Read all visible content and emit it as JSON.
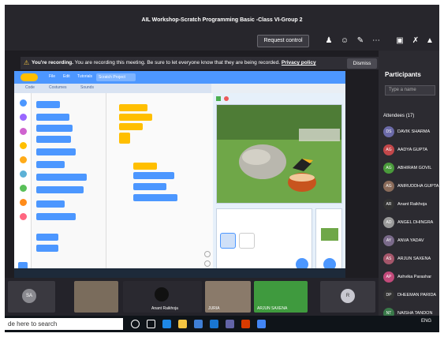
{
  "meeting": {
    "title": "AIL Workshop-Scratch Programming Basic -Class VI-Group 2",
    "request_control": "Request control"
  },
  "banner": {
    "lead": "You're recording.",
    "message": "You are recording this meeting. Be sure to let everyone know that they are being recorded.",
    "policy_link": "Privacy policy",
    "dismiss": "Dismiss"
  },
  "participants": {
    "title": "Participants",
    "search_placeholder": "Type a name",
    "attendees_header": "Attendees (17)",
    "list": [
      {
        "initials": "DS",
        "name": "DAVIK SHARMA",
        "color": "#6b6aa8"
      },
      {
        "initials": "AG",
        "name": "AADYA GUPTA",
        "color": "#c2474a"
      },
      {
        "initials": "AG",
        "name": "ABHIRAM GOVIL",
        "color": "#4a9a3b"
      },
      {
        "initials": "AG",
        "name": "ANIRUDDHA GUPTA",
        "color": "#8a6b5a"
      },
      {
        "initials": "AR",
        "name": "Anant Raikhoja",
        "color": "#333333"
      },
      {
        "initials": "AD",
        "name": "ANGEL DHINGRA",
        "color": "#9a9a9a"
      },
      {
        "initials": "AY",
        "name": "ANVA YADAV",
        "color": "#7a6a8a"
      },
      {
        "initials": "AS",
        "name": "ARJUN SAXENA",
        "color": "#a5566a"
      },
      {
        "initials": "AP",
        "name": "Ashvika Parashar",
        "color": "#c24a7a"
      },
      {
        "initials": "DP",
        "name": "DHEEMAN PARIDA",
        "color": "#333333"
      },
      {
        "initials": "NT",
        "name": "NAISHA TANDON",
        "color": "#3a7a4a"
      }
    ]
  },
  "gallery": {
    "tiles": [
      {
        "name": "SA",
        "label": ""
      },
      {
        "name": "",
        "label": "Anant Raikhoja"
      },
      {
        "name": "",
        "label": "JURIA"
      },
      {
        "name": "",
        "label": "ARJUN SAXENA"
      },
      {
        "name": "R",
        "label": ""
      }
    ]
  },
  "scratch": {
    "menu": [
      "File",
      "Edit",
      "Tutorials"
    ],
    "project_title": "Scratch Project",
    "tabs": [
      "Code",
      "Costumes",
      "Sounds"
    ]
  },
  "windows": {
    "search_placeholder": "de here to search",
    "lang": "ENG"
  },
  "colors": {
    "teams_dark": "#1e1d22",
    "scratch_blue": "#4d97ff",
    "scratch_yellow": "#ffbf00"
  }
}
